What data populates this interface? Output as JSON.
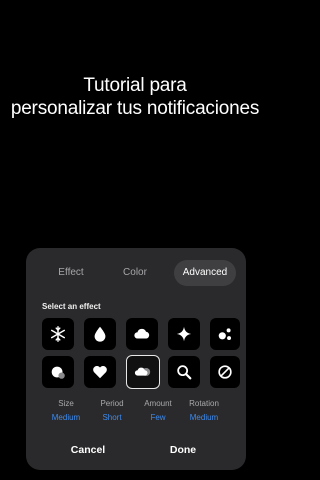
{
  "title": {
    "line1": "Tutorial para",
    "line2": "personalizar tus notificaciones"
  },
  "tabs": [
    {
      "label": "Effect",
      "selected": false
    },
    {
      "label": "Color",
      "selected": false
    },
    {
      "label": "Advanced",
      "selected": true
    }
  ],
  "effects": {
    "label": "Select an effect",
    "items": [
      {
        "icon": "snowflake-icon"
      },
      {
        "icon": "drop-icon"
      },
      {
        "icon": "cloud-icon"
      },
      {
        "icon": "sparkle-icon"
      },
      {
        "icon": "dots-icon"
      },
      {
        "icon": "bubbles-icon"
      },
      {
        "icon": "heart-icon"
      },
      {
        "icon": "cloud-pair-icon",
        "selected": true
      },
      {
        "icon": "magnifier-icon"
      },
      {
        "icon": "none-icon"
      }
    ]
  },
  "params": [
    {
      "label": "Size",
      "value": "Medium"
    },
    {
      "label": "Period",
      "value": "Short"
    },
    {
      "label": "Amount",
      "value": "Few"
    },
    {
      "label": "Rotation",
      "value": "Medium"
    }
  ],
  "actions": {
    "cancel": "Cancel",
    "done": "Done"
  },
  "colors": {
    "accent": "#3d8bf0",
    "sheet": "#2a2a2c",
    "selected_tab": "#3f3f42"
  }
}
